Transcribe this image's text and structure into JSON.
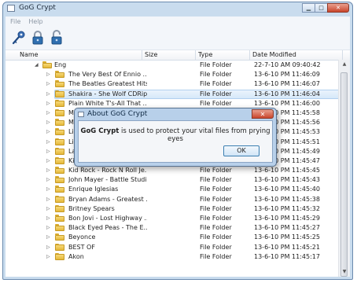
{
  "window": {
    "title": "GoG Crypt"
  },
  "menu": [
    "File",
    "Help"
  ],
  "toolbar": {
    "buttons": [
      {
        "name": "key-icon",
        "color": "#3b6fb6"
      },
      {
        "name": "lock-icon",
        "color": "#2f6fb0"
      },
      {
        "name": "unlock-icon",
        "color": "#2f6fb0"
      }
    ]
  },
  "columns": {
    "name": "Name",
    "size": "Size",
    "type": "Type",
    "date": "Date Modified"
  },
  "root": {
    "name": "Eng",
    "type": "File Folder",
    "date": "22-7-10 AM 09:40:42"
  },
  "rows": [
    {
      "name": "The Very Best Of Ennio ...",
      "type": "File Folder",
      "date": "13-6-10 PM 11:46:09"
    },
    {
      "name": "The Beatles Greatest Hits",
      "type": "File Folder",
      "date": "13-6-10 PM 11:46:07"
    },
    {
      "name": "Shakira - She Wolf CDRip...",
      "type": "File Folder",
      "date": "13-6-10 PM 11:46:04"
    },
    {
      "name": "Plain White T's-All That ...",
      "type": "File Folder",
      "date": "13-6-10 PM 11:46:00"
    },
    {
      "name": "Mu",
      "type": "File Folder",
      "date": "13-6-10 PM 11:45:58"
    },
    {
      "name": "Mic",
      "type": "File Folder",
      "date": "13-6-10 PM 11:45:56"
    },
    {
      "name": "Link",
      "type": "File Folder",
      "date": "13-6-10 PM 11:45:53"
    },
    {
      "name": "Lily",
      "type": "File Folder",
      "date": "13-6-10 PM 11:45:51"
    },
    {
      "name": "Lad",
      "type": "File Folder",
      "date": "13-6-10 PM 11:45:49"
    },
    {
      "name": "Kin",
      "type": "File Folder",
      "date": "13-6-10 PM 11:45:47"
    },
    {
      "name": "Kid Rock - Rock N Roll Je...",
      "type": "File Folder",
      "date": "13-6-10 PM 11:45:45"
    },
    {
      "name": "John Mayer - Battle Studi...",
      "type": "File Folder",
      "date": "13-6-10 PM 11:45:43"
    },
    {
      "name": "Enrique Iglesias",
      "type": "File Folder",
      "date": "13-6-10 PM 11:45:40"
    },
    {
      "name": "Bryan Adams - Greatest ...",
      "type": "File Folder",
      "date": "13-6-10 PM 11:45:38"
    },
    {
      "name": "Britney Spears",
      "type": "File Folder",
      "date": "13-6-10 PM 11:45:32"
    },
    {
      "name": "Bon Jovi - Lost Highway ...",
      "type": "File Folder",
      "date": "13-6-10 PM 11:45:29"
    },
    {
      "name": "Black Eyed Peas - The E...",
      "type": "File Folder",
      "date": "13-6-10 PM 11:45:27"
    },
    {
      "name": "Beyonce",
      "type": "File Folder",
      "date": "13-6-10 PM 11:45:25"
    },
    {
      "name": "BEST OF",
      "type": "File Folder",
      "date": "13-6-10 PM 11:45:21"
    },
    {
      "name": "Akon",
      "type": "File Folder",
      "date": "13-6-10 PM 11:45:17"
    }
  ],
  "selected_row": 2,
  "dialog": {
    "title": "About GoG Crypt",
    "app_name": "GoG Crypt",
    "message": " is used to protect your vital files from prying eyes",
    "ok": "OK",
    "close": "✕"
  },
  "colors": {
    "folder": "#e4b83a",
    "selection": "#d6e8f9",
    "window_frame": "#c9dcee"
  }
}
